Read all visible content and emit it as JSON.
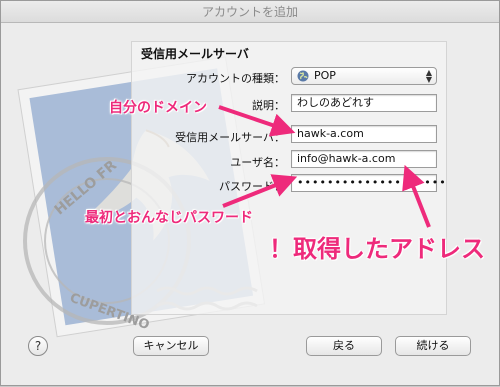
{
  "window": {
    "title": "アカウントを追加"
  },
  "form": {
    "section_title": "受信用メールサーバ",
    "account_type": {
      "label": "アカウントの種類：",
      "value": "POP"
    },
    "description": {
      "label": "説明：",
      "value": "わしのあどれす"
    },
    "incoming_server": {
      "label": "受信用メールサーバ：",
      "value": "hawk-a.com"
    },
    "username": {
      "label": "ユーザ名：",
      "value": "info@hawk-a.com"
    },
    "password": {
      "label": "パスワード：",
      "value": "••••••••••••••••••••"
    }
  },
  "stamp": {
    "text_top": "HELLO FR",
    "text_bottom": "CUPERTINO"
  },
  "annotations": {
    "domain": "自分のドメイン",
    "same_password": "最初とおんなじパスワード",
    "address": "！取得したアドレス"
  },
  "buttons": {
    "help": "?",
    "cancel": "キャンセル",
    "back": "戻る",
    "continue": "続ける"
  },
  "colors": {
    "annotation": "#ee2a7b",
    "stamp_blue": "#8fa5c4"
  }
}
